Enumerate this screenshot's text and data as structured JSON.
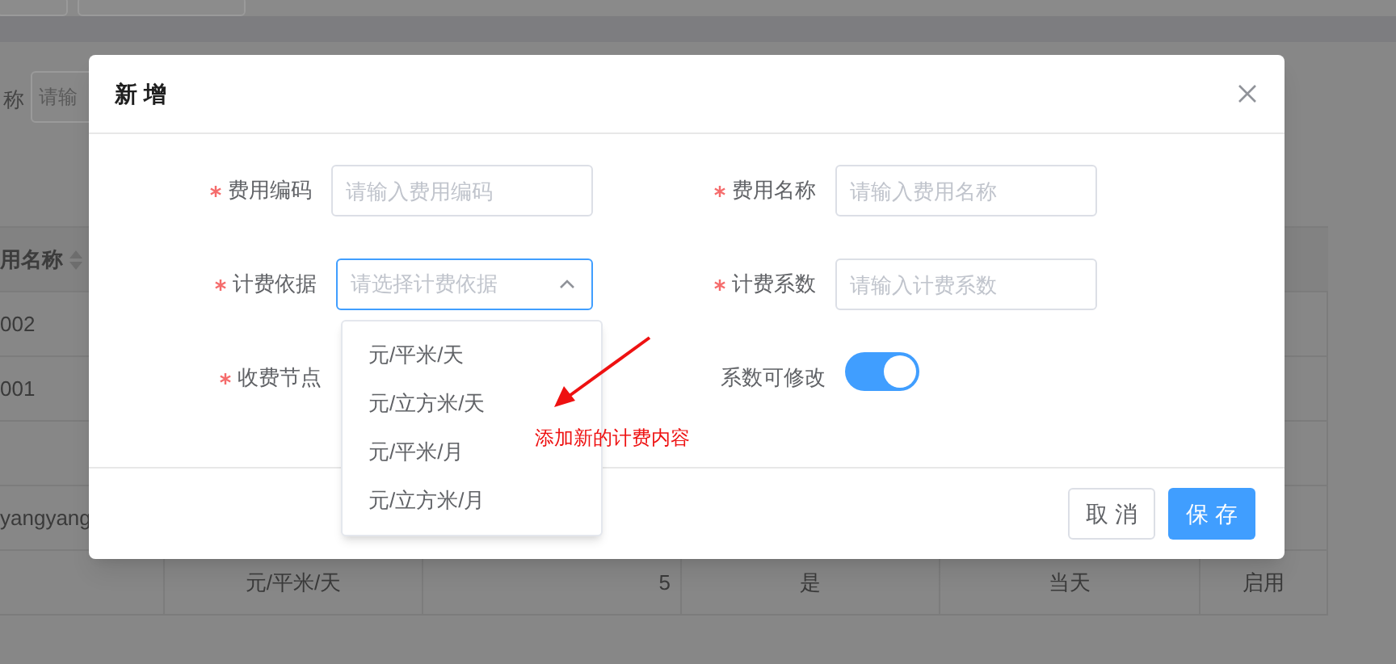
{
  "search": {
    "label": "称",
    "placeholder": "请输"
  },
  "table": {
    "header": "用名称",
    "rows": [
      {
        "column_1": "002"
      },
      {
        "column_1": "001"
      },
      {},
      {
        "column_1": "yangyang"
      },
      {
        "column_2": "元/平米/天",
        "column_3": "5",
        "column_4": "是",
        "column_5": "当天",
        "column_6": "启用"
      }
    ]
  },
  "dialog": {
    "title": "新 增",
    "fields": [
      {
        "label": "费用编码",
        "kind": "input",
        "required": true,
        "placeholder": "请输入费用编码"
      },
      {
        "label": "费用名称",
        "kind": "input",
        "required": true,
        "placeholder": "请输入费用名称"
      },
      {
        "label": "计费依据",
        "kind": "select",
        "required": true,
        "placeholder": "请选择计费依据",
        "expanded": true,
        "options": [
          "元/平米/天",
          "元/立方米/天",
          "元/平米/月",
          "元/立方米/月"
        ]
      },
      {
        "label": "计费系数",
        "kind": "input",
        "required": true,
        "placeholder": "请输入计费系数"
      },
      {
        "label": "收费节点",
        "kind": "hidden",
        "required": true
      },
      {
        "label": "系数可修改",
        "kind": "switch",
        "required": false,
        "on": true
      }
    ],
    "buttons": [
      {
        "label": "取 消",
        "kind": "default"
      },
      {
        "label": "保 存",
        "kind": "primary"
      }
    ]
  },
  "annotation": {
    "text": "添加新的计费内容"
  }
}
